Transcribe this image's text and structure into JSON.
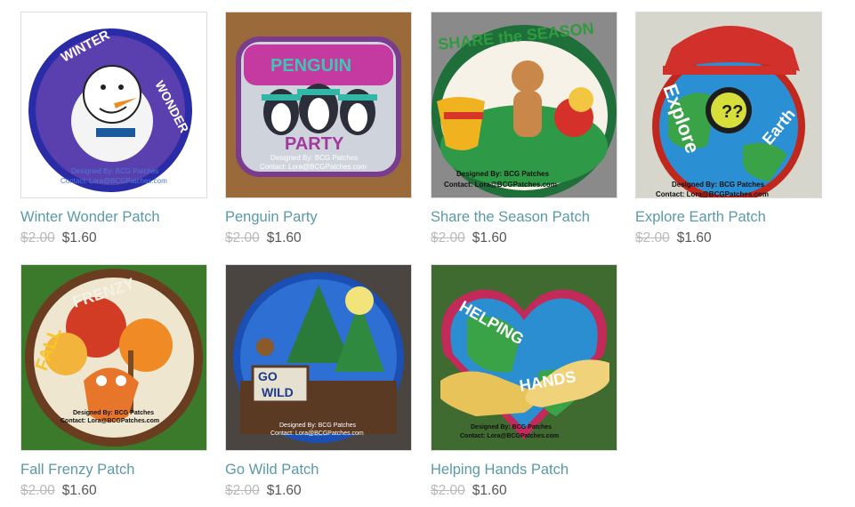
{
  "products": [
    {
      "title": "Winter Wonder Patch",
      "old_price": "$2.00",
      "price": "$1.60",
      "patch_text": [
        "WINTER",
        "WONDER"
      ]
    },
    {
      "title": "Penguin Party",
      "old_price": "$2.00",
      "price": "$1.60",
      "patch_text": [
        "PENGUIN",
        "PARTY"
      ]
    },
    {
      "title": "Share the Season Patch",
      "old_price": "$2.00",
      "price": "$1.60",
      "patch_text": [
        "SHARE the SEASON"
      ]
    },
    {
      "title": "Explore Earth Patch",
      "old_price": "$2.00",
      "price": "$1.60",
      "patch_text": [
        "Explore",
        "Earth"
      ]
    },
    {
      "title": "Fall Frenzy Patch",
      "old_price": "$2.00",
      "price": "$1.60",
      "patch_text": [
        "FALL",
        "FRENZY"
      ]
    },
    {
      "title": "Go Wild Patch",
      "old_price": "$2.00",
      "price": "$1.60",
      "patch_text": [
        "GO",
        "WILD"
      ]
    },
    {
      "title": "Helping Hands Patch",
      "old_price": "$2.00",
      "price": "$1.60",
      "patch_text": [
        "HELPING",
        "HANDS"
      ]
    }
  ],
  "watermark": {
    "line1": "Designed By: BCG Patches",
    "line2": "Contact: Lora@BCGPatches.com"
  },
  "colors": {
    "title": "#5a9aa6",
    "old_price": "#b9b9b9",
    "price": "#555555"
  }
}
